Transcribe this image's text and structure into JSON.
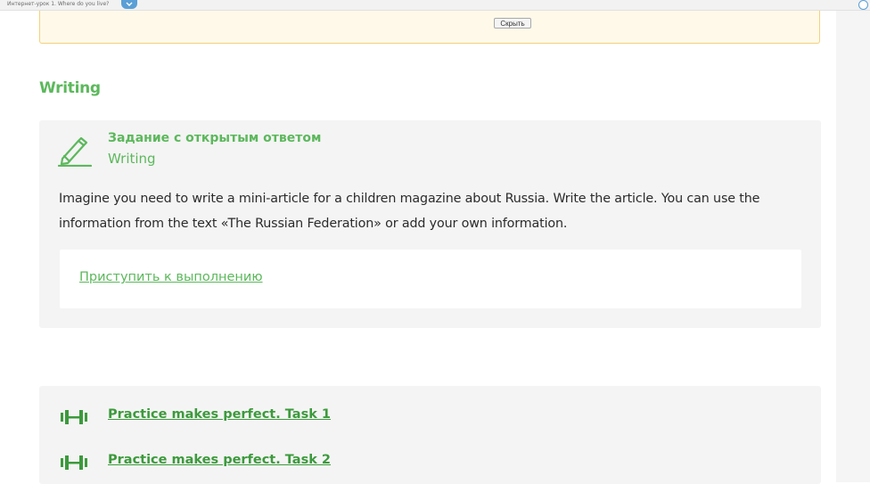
{
  "browser_bar": {
    "tab_text": "Интернет-урок 1. Where do you live?"
  },
  "notice": {
    "hide_label": "Скрыть"
  },
  "section": {
    "title": "Writing"
  },
  "task": {
    "type_label": "Задание с открытым ответом",
    "subtitle": "Writing",
    "description": "Imagine you need to write a mini-article for a children magazine about Russia. Write the article. You can use the information from the text «The Russian Federation» or add your own information.",
    "start_link": "Приступить к выполнению",
    "icon": "pencil-icon"
  },
  "practice": {
    "icon": "dumbbell-icon",
    "items": [
      {
        "label": "Practice makes perfect. Task 1"
      },
      {
        "label": "Practice makes perfect. Task 2"
      }
    ]
  },
  "colors": {
    "accent_green": "#5cb85c",
    "link_green": "#3c9a3c",
    "card_bg": "#f4f4f4",
    "notice_border": "#f3d27d"
  }
}
